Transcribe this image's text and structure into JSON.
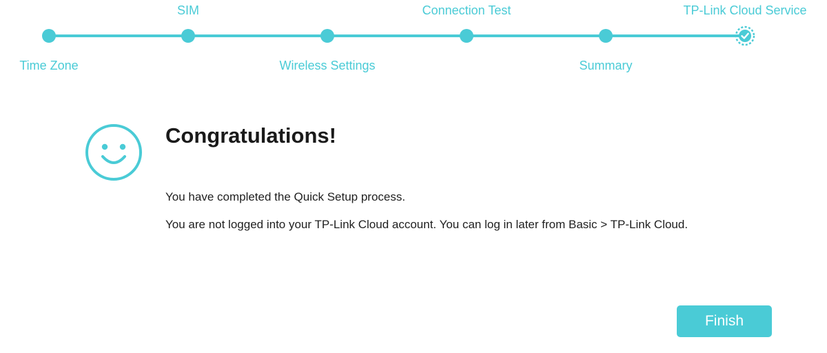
{
  "colors": {
    "accent": "#4acbd6",
    "text": "#1f1f1f",
    "background": "#ffffff"
  },
  "stepper": {
    "steps": [
      {
        "label": "Time Zone",
        "state": "completed"
      },
      {
        "label": "SIM",
        "state": "completed"
      },
      {
        "label": "Wireless Settings",
        "state": "completed"
      },
      {
        "label": "Connection Test",
        "state": "completed"
      },
      {
        "label": "Summary",
        "state": "completed"
      },
      {
        "label": "TP-Link Cloud Service",
        "state": "current"
      }
    ]
  },
  "content": {
    "icon": "smiley-face-icon",
    "title": "Congratulations!",
    "message1": "You have completed the Quick Setup process.",
    "message2": "You are not logged into your TP-Link Cloud account. You can log in later from Basic > TP-Link Cloud."
  },
  "actions": {
    "finish_label": "Finish"
  }
}
